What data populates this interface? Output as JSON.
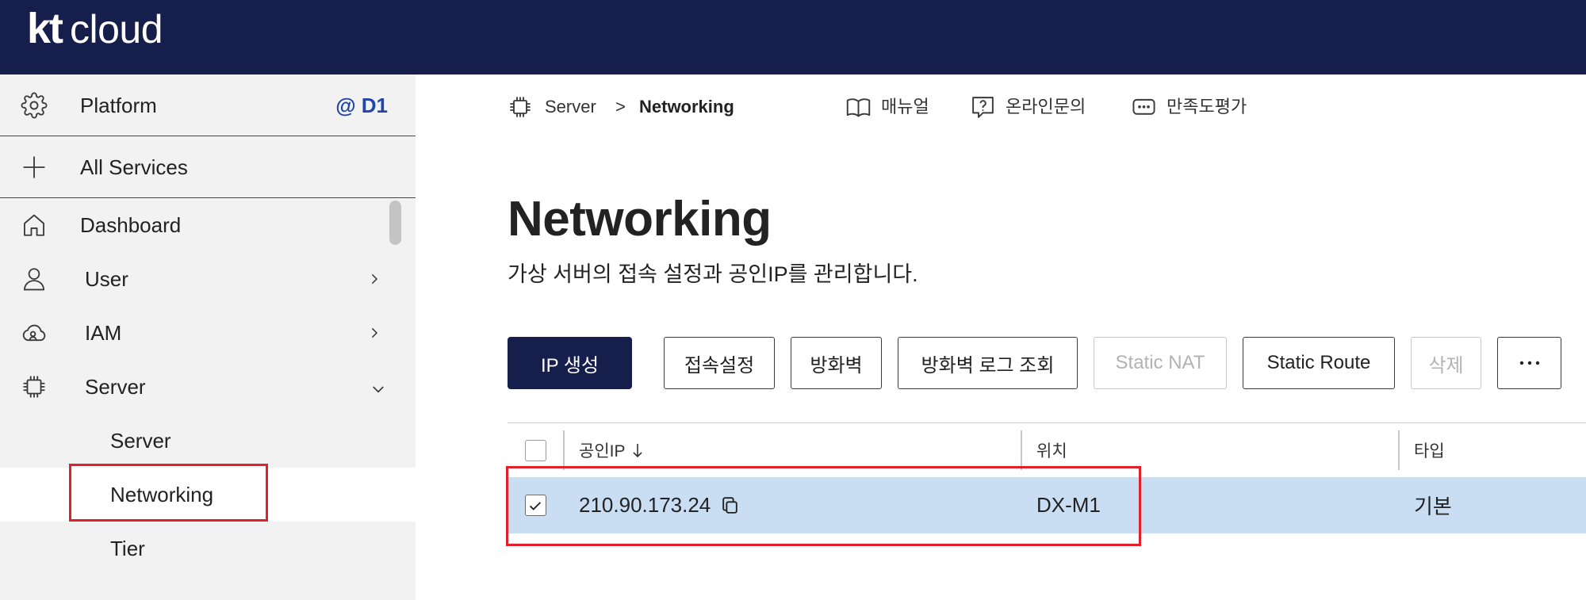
{
  "header": {
    "logo": {
      "kt": "kt",
      "cloud": "cloud"
    }
  },
  "sidebar": {
    "platform": {
      "icon": "gear-icon",
      "label": "Platform",
      "badge": "@ D1"
    },
    "all_services": {
      "icon": "plus-icon",
      "label": "All Services"
    },
    "items": [
      {
        "icon": "home-icon",
        "label": "Dashboard"
      },
      {
        "icon": "user-icon",
        "label": "User",
        "chevron": "chevron-right-icon"
      },
      {
        "icon": "cloud-icon",
        "label": "IAM",
        "chevron": "chevron-right-icon"
      },
      {
        "icon": "chip-icon",
        "label": "Server",
        "chevron": "chevron-down-icon",
        "expanded": true
      }
    ],
    "server_submenu": [
      {
        "label": "Server",
        "active": false
      },
      {
        "label": "Networking",
        "active": true
      },
      {
        "label": "Tier",
        "active": false
      }
    ]
  },
  "breadcrumb": {
    "icon": "chip-icon",
    "parent": "Server",
    "separator": ">",
    "current": "Networking"
  },
  "help_links": [
    {
      "icon": "book-icon",
      "label": "매뉴얼"
    },
    {
      "icon": "question-bubble-icon",
      "label": "온라인문의"
    },
    {
      "icon": "dots-bubble-icon",
      "label": "만족도평가"
    }
  ],
  "page": {
    "title": "Networking",
    "subtitle": "가상 서버의 접속 설정과 공인IP를 관리합니다."
  },
  "toolbar": {
    "buttons": [
      {
        "label": "IP 생성",
        "primary": true,
        "disabled": false
      },
      {
        "label": "접속설정",
        "disabled": false
      },
      {
        "label": "방화벽",
        "disabled": false
      },
      {
        "label": "방화벽 로그 조회",
        "disabled": false
      },
      {
        "label": "Static NAT",
        "disabled": true
      },
      {
        "label": "Static Route",
        "disabled": false
      },
      {
        "label": "삭제",
        "disabled": true
      },
      {
        "icon": "more-icon",
        "disabled": false
      }
    ]
  },
  "table": {
    "select_all_checked": false,
    "columns": [
      {
        "label": "공인IP",
        "sort_icon": "sort-down-icon"
      },
      {
        "label": "위치"
      },
      {
        "label": "타입"
      }
    ],
    "rows": [
      {
        "selected": true,
        "public_ip": "210.90.173.24",
        "copy_icon": "copy-icon",
        "location": "DX-M1",
        "type": "기본"
      }
    ]
  },
  "colors": {
    "header_bg": "#161e4b",
    "primary_button_bg": "#161e4b",
    "badge_text": "#1f46a8",
    "sidebar_bg": "#f2f2f2",
    "selected_row_bg": "#c9def3",
    "highlight_box": "#e0202a"
  }
}
